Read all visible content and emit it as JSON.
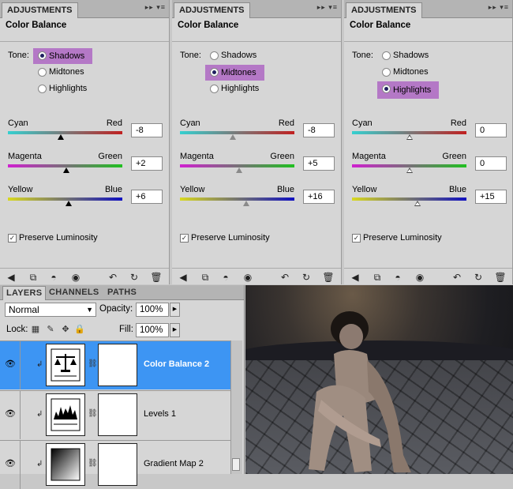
{
  "adjustment_panels": [
    {
      "tab_label": "ADJUSTMENTS",
      "title": "Color Balance",
      "tone_label": "Tone:",
      "tones": [
        "Shadows",
        "Midtones",
        "Highlights"
      ],
      "selected_tone": "Shadows",
      "sliders": [
        {
          "left": "Cyan",
          "right": "Red",
          "value": "-8",
          "position": 0.46
        },
        {
          "left": "Magenta",
          "right": "Green",
          "value": "+2",
          "position": 0.51
        },
        {
          "left": "Yellow",
          "right": "Blue",
          "value": "+6",
          "position": 0.53
        }
      ],
      "preserve_luminosity": "Preserve Luminosity"
    },
    {
      "tab_label": "ADJUSTMENTS",
      "title": "Color Balance",
      "tone_label": "Tone:",
      "tones": [
        "Shadows",
        "Midtones",
        "Highlights"
      ],
      "selected_tone": "Midtones",
      "sliders": [
        {
          "left": "Cyan",
          "right": "Red",
          "value": "-8",
          "position": 0.46
        },
        {
          "left": "Magenta",
          "right": "Green",
          "value": "+5",
          "position": 0.52
        },
        {
          "left": "Yellow",
          "right": "Blue",
          "value": "+16",
          "position": 0.58
        }
      ],
      "preserve_luminosity": "Preserve Luminosity"
    },
    {
      "tab_label": "ADJUSTMENTS",
      "title": "Color Balance",
      "tone_label": "Tone:",
      "tones": [
        "Shadows",
        "Midtones",
        "Highlights"
      ],
      "selected_tone": "Highlights",
      "sliders": [
        {
          "left": "Cyan",
          "right": "Red",
          "value": "0",
          "position": 0.5
        },
        {
          "left": "Magenta",
          "right": "Green",
          "value": "0",
          "position": 0.5
        },
        {
          "left": "Yellow",
          "right": "Blue",
          "value": "+15",
          "position": 0.57
        }
      ],
      "preserve_luminosity": "Preserve Luminosity"
    }
  ],
  "layers_panel": {
    "tabs": [
      "LAYERS",
      "CHANNELS",
      "PATHS"
    ],
    "blend_mode": "Normal",
    "opacity_label": "Opacity:",
    "opacity": "100%",
    "lock_label": "Lock:",
    "fill_label": "Fill:",
    "fill": "100%",
    "layers": [
      {
        "name": "Color Balance 2",
        "selected": true,
        "icon": "balance-scale-icon"
      },
      {
        "name": "Levels 1",
        "selected": false,
        "icon": "histogram-icon"
      },
      {
        "name": "Gradient Map 2",
        "selected": false,
        "icon": "gradient-icon"
      }
    ]
  },
  "colors": {
    "highlight_purple": "#b478c6",
    "selection_blue": "#3d95f3"
  }
}
